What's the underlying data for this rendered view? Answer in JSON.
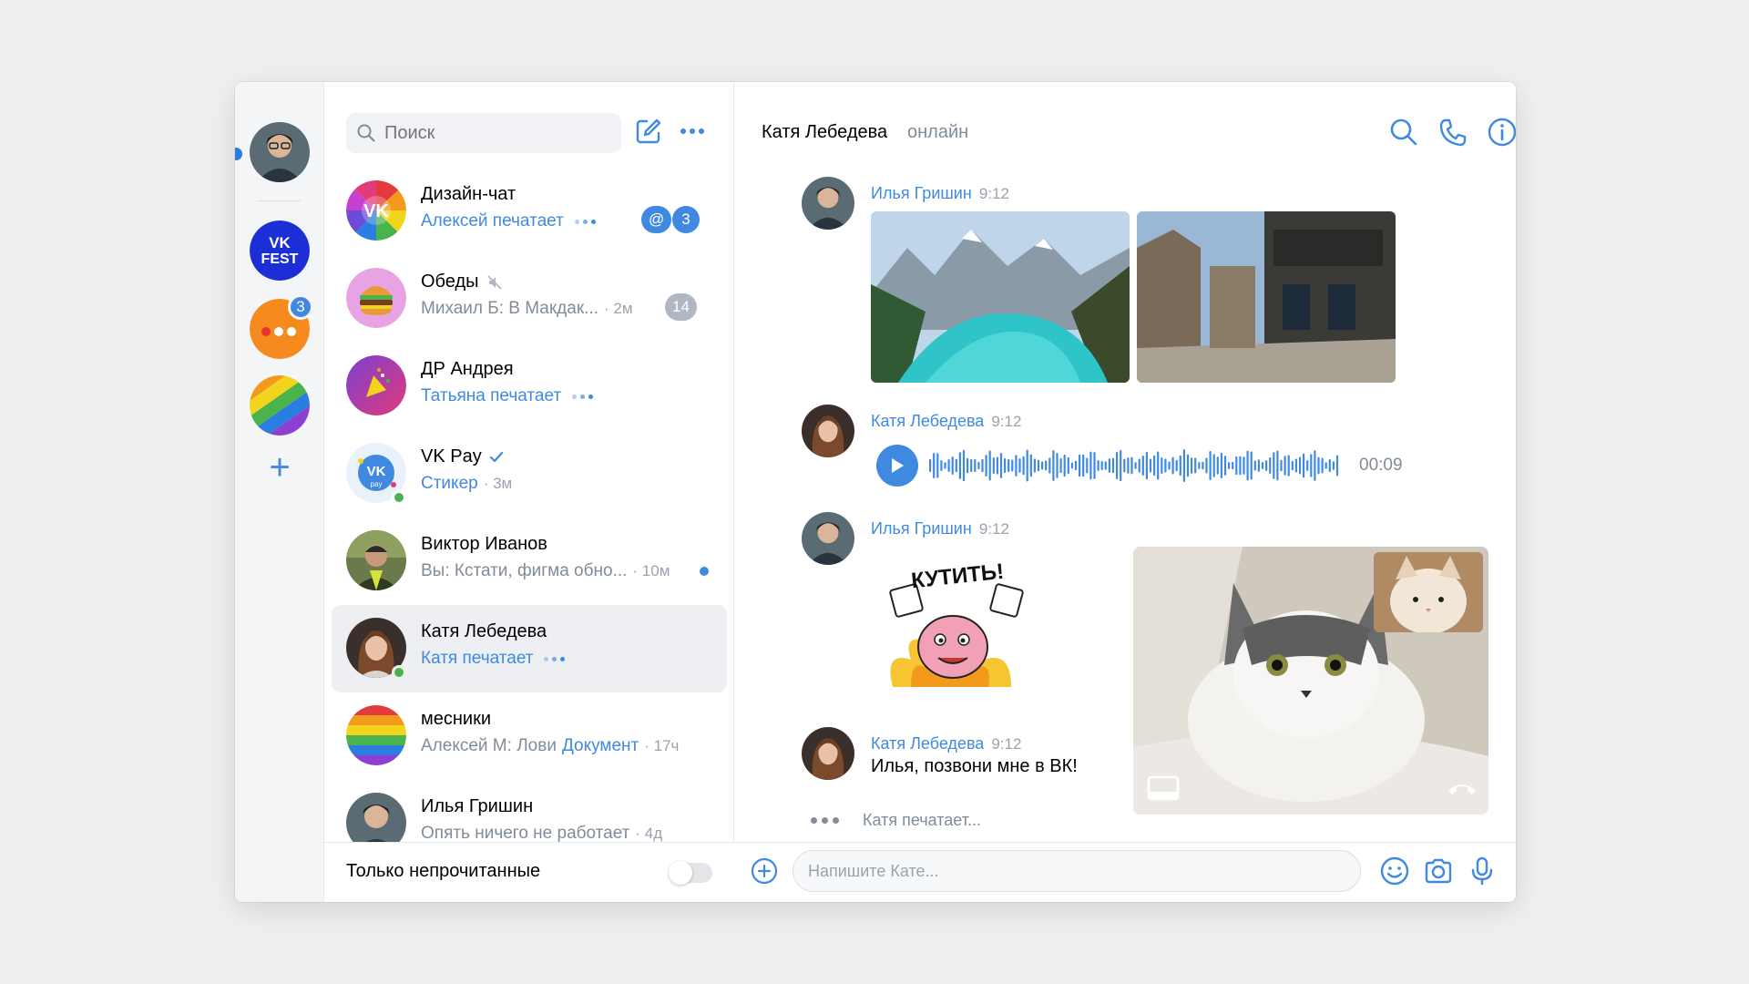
{
  "search": {
    "placeholder": "Поиск"
  },
  "chats": [
    {
      "name": "Дизайн-чат",
      "sub": "Алексей печатает",
      "mention": "@",
      "count": "3"
    },
    {
      "name": "Обеды",
      "sub_prefix": "Михаил Б: В Макдак...",
      "time": "· 2м",
      "count": "14"
    },
    {
      "name": "ДР Андрея",
      "sub": "Татьяна печатает"
    },
    {
      "name": "VK Pay",
      "sub": "Стикер",
      "time": "· 3м"
    },
    {
      "name": "Виктор Иванов",
      "sub_prefix": "Вы: Кстати, фигма обно...",
      "time": "· 10м"
    },
    {
      "name": "Катя Лебедева",
      "sub": "Катя печатает"
    },
    {
      "name": "месники",
      "sub_prefix": "Алексей М: Лови",
      "sub_link": "Документ",
      "time": "· 17ч"
    },
    {
      "name": "Илья Гришин",
      "sub_prefix": "Опять ничего не работает",
      "time": "· 4д"
    }
  ],
  "rail": {
    "vk_badge_top": "VK",
    "vk_badge_bottom": "FEST",
    "notif_count": "3"
  },
  "footer": {
    "label": "Только непрочитанные"
  },
  "conversation": {
    "name": "Катя Лебедева",
    "status": "онлайн",
    "messages": [
      {
        "author": "Илья Гришин",
        "time": "9:12"
      },
      {
        "author": "Катя Лебедева",
        "time": "9:12",
        "audio_duration": "00:09"
      },
      {
        "author": "Илья Гришин",
        "time": "9:12",
        "sticker_text": "КУТИТЬ!"
      },
      {
        "author": "Катя Лебедева",
        "time": "9:12",
        "text": "Илья, позвони мне в ВК!"
      }
    ],
    "typing": "Катя печатает...",
    "composer_placeholder": "Напишите Кате..."
  },
  "colors": {
    "accent": "#3f8ae0",
    "online": "#4bb34b",
    "counter_muted": "#aeb7c2"
  }
}
